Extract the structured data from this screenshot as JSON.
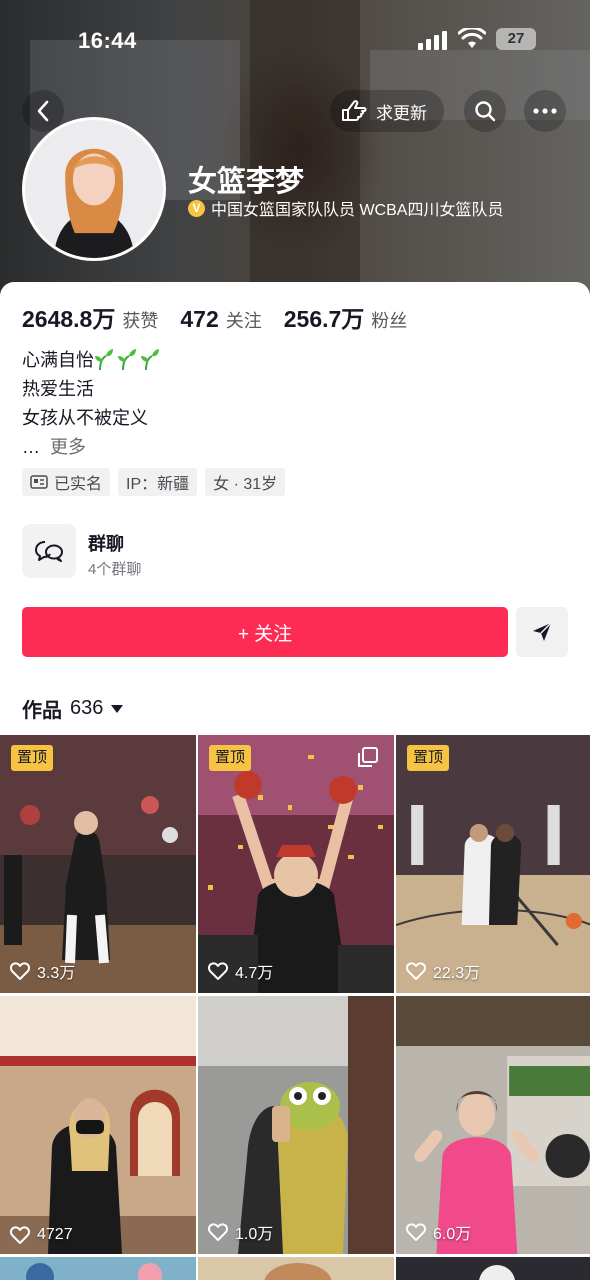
{
  "status_bar": {
    "time": "16:44",
    "battery": "27"
  },
  "header": {
    "request_update": "求更新",
    "name": "女篮李梦",
    "verified_text": "中国女篮国家队队员 WCBA四川女篮队员"
  },
  "stats": [
    {
      "value": "2648.8万",
      "label": "获赞"
    },
    {
      "value": "472",
      "label": "关注"
    },
    {
      "value": "256.7万",
      "label": "粉丝"
    }
  ],
  "bio": {
    "line1": "心满自怡",
    "line2": "热爱生活",
    "line3": "女孩从不被定义",
    "ellipsis": "…",
    "more": "更多"
  },
  "tags": [
    "已实名",
    "IP：新疆",
    "女 · 31岁"
  ],
  "group_chat": {
    "title": "群聊",
    "subtitle": "4个群聊"
  },
  "follow_button": "+ 关注",
  "works": {
    "label": "作品",
    "count": "636"
  },
  "posts": [
    {
      "pinned": true,
      "pin_label": "置顶",
      "likes": "3.3万"
    },
    {
      "pinned": true,
      "pin_label": "置顶",
      "likes": "4.7万"
    },
    {
      "pinned": true,
      "pin_label": "置顶",
      "likes": "22.3万"
    },
    {
      "pinned": false,
      "likes": "4727"
    },
    {
      "pinned": false,
      "likes": "1.0万"
    },
    {
      "pinned": false,
      "likes": "6.0万"
    }
  ],
  "colors": {
    "accent": "#fe2c55",
    "pin": "#f6c343"
  }
}
